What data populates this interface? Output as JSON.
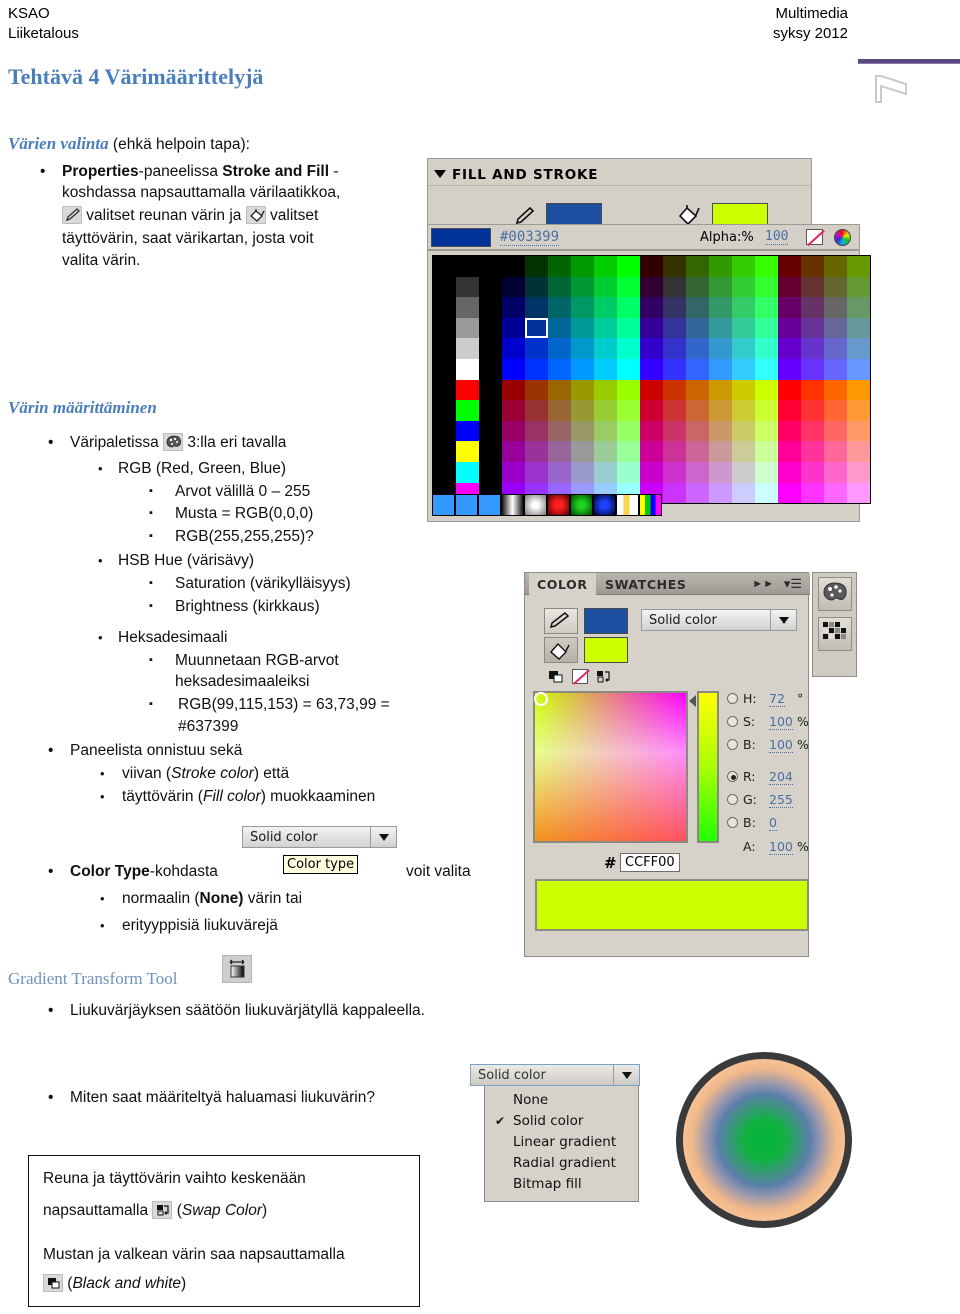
{
  "header": {
    "org": "KSAO",
    "dept": "Liiketalous",
    "course": "Multimedia",
    "term": "syksy 2012",
    "flag_icon": "flag-icon"
  },
  "page_title": "Tehtävä 4 Värimäärittelyjä",
  "sections": {
    "color_selection": {
      "heading": "Värien valinta",
      "heading_rest": " (ehkä helpoin tapa):",
      "bullet": {
        "line1_bold1": "Properties",
        "line1_mid": "-paneelissa ",
        "line1_bold2": "Stroke and Fill",
        "line1_end": " -",
        "line2": "koshdassa napsauttamalla värilaatikkoa,",
        "line3_a": " valitset reunan värin ja ",
        "line3_b": " valitset",
        "line4": "täyttövärin, saat värikartan, josta voit",
        "line5": "valita värin."
      }
    },
    "color_definition": {
      "heading": "Värin määrittäminen",
      "items": [
        {
          "level": 1,
          "text_before": "Väripaletissa ",
          "icon": "palette-icon",
          "text_after": " 3:lla eri tavalla"
        },
        {
          "level": 2,
          "text": "RGB (Red, Green, Blue)"
        },
        {
          "level": 3,
          "text": "Arvot välillä 0 – 255"
        },
        {
          "level": 3,
          "text": "Musta = RGB(0,0,0)"
        },
        {
          "level": 3,
          "text": "RGB(255,255,255)?"
        },
        {
          "level": 2,
          "text": "HSB Hue (värisävy)"
        },
        {
          "level": 3,
          "text": "Saturation (värikylläisyys)"
        },
        {
          "level": 3,
          "text": "Brightness (kirkkaus)"
        },
        {
          "level": 2,
          "text": "Heksadesimaali"
        },
        {
          "level": 3,
          "text": "Muunnetaan RGB-arvot"
        },
        {
          "level": 3,
          "continuation": true,
          "text": "heksadesimaaleiksi"
        },
        {
          "level": 3,
          "text": "RGB(99,115,153) = 63,73,99 ="
        },
        {
          "level": 3,
          "continuation": true,
          "text": "#637399"
        },
        {
          "level": 1,
          "text": "Paneelista onnistuu sekä"
        },
        {
          "level": 2,
          "text_plain": "viivan (",
          "text_italic": "Stroke color",
          "text_tail": ") että"
        },
        {
          "level": 2,
          "text_plain": "täyttövärin (",
          "text_italic": "Fill color",
          "text_tail": ") muokkaaminen"
        }
      ],
      "color_type": {
        "bold": "Color Type",
        "rest": "-kohdasta",
        "combo_value": "Solid color",
        "tooltip": "Color type",
        "tail": "voit valita",
        "sub1_a": "normaalin (",
        "sub1_b": "None)",
        "sub1_c": " värin tai",
        "sub2": "erityyppisiä liukuvärejä"
      }
    },
    "gradient_tool": {
      "heading": "Gradient Transform Tool",
      "icon": "gradient-transform-icon",
      "bullet": "Liukuvärjäyksen säätöön liukuvärjätyllä kappaleella."
    },
    "question": "Miten saat määriteltyä haluamasi liukuvärin?",
    "note_box": {
      "line1": "Reuna ja täyttövärin vaihto keskenään",
      "line2_a": "napsauttamalla ",
      "line2_icon": "swap-color-icon",
      "line2_b": " (",
      "line2_italic": "Swap Color",
      "line2_c": ")",
      "line3": "Mustan ja valkean värin saa napsauttamalla",
      "line4_icon": "black-and-white-icon",
      "line4_a": " (",
      "line4_italic": "Black and white",
      "line4_b": ")"
    }
  },
  "fill_and_stroke_panel": {
    "title": "FILL AND STROKE",
    "stroke_icon": "pencil-icon",
    "fill_icon": "paint-bucket-icon",
    "stroke_color": "#1d4fa0",
    "fill_color": "#ccff00",
    "current_swatch": "#003399",
    "hex_value": "#003399",
    "alpha_label": "Alpha:%",
    "alpha_value": "100",
    "no_color_icon": "no-color-icon",
    "color_wheel_icon": "color-wheel-icon",
    "selected_swatch": "#0033aa"
  },
  "color_panel": {
    "tabs": [
      {
        "label": "COLOR",
        "active": true
      },
      {
        "label": "SWATCHES",
        "active": false
      }
    ],
    "expand_icon": "double-chevron-icon",
    "menu_icon": "panel-menu-icon",
    "side_buttons": [
      {
        "icon": "palette-icon"
      },
      {
        "icon": "swatches-grid-icon"
      }
    ],
    "stroke_icon": "pencil-icon",
    "fill_icon": "paint-bucket-icon",
    "stroke_color": "#1d4fa0",
    "fill_color": "#ccff00",
    "black_white_icon": "black-and-white-icon",
    "no_color_icon": "no-color-icon",
    "swap_color_icon": "swap-color-icon",
    "color_type_value": "Solid color",
    "fields": [
      {
        "name": "H",
        "value": "72",
        "unit": "°",
        "selected": false
      },
      {
        "name": "S",
        "value": "100",
        "unit": "%",
        "selected": false
      },
      {
        "name": "B",
        "value": "100",
        "unit": "%",
        "selected": false
      },
      {
        "name": "R",
        "value": "204",
        "unit": "",
        "selected": true
      },
      {
        "name": "G",
        "value": "255",
        "unit": "",
        "selected": false
      },
      {
        "name": "B",
        "value": "0",
        "unit": "",
        "selected": false
      },
      {
        "name": "A",
        "value": "100",
        "unit": "%",
        "selected": null
      }
    ],
    "hex_symbol": "#",
    "hex_value": "CCFF00",
    "preview_color": "#ccff00"
  },
  "color_type_dropdown": {
    "selected": "Solid color",
    "options": [
      {
        "label": "None",
        "checked": false
      },
      {
        "label": "Solid color",
        "checked": true
      },
      {
        "label": "Linear gradient",
        "checked": false
      },
      {
        "label": "Radial gradient",
        "checked": false
      },
      {
        "label": "Bitmap fill",
        "checked": false
      }
    ]
  },
  "gradient_circle": {
    "name": "radial-gradient-circle",
    "center_color": "#00b33c",
    "mid_color": "#5b7fa8",
    "outer_color": "#f8c79c",
    "stroke_color": "#3a3a3c"
  },
  "palette_grid": {
    "rows": [
      [
        "#000000",
        "#000000",
        "#000000",
        "#000000",
        "#003300",
        "#006600",
        "#009900",
        "#00cc00",
        "#00ff00",
        "#330000",
        "#333300",
        "#336600",
        "#339900",
        "#33cc00",
        "#33ff00",
        "#660000",
        "#663300",
        "#666600",
        "#669900"
      ],
      [
        "#000000",
        "#333333",
        "#000000",
        "#000033",
        "#003333",
        "#006633",
        "#009933",
        "#00cc33",
        "#00ff33",
        "#330033",
        "#333333",
        "#336633",
        "#339933",
        "#33cc33",
        "#33ff33",
        "#660033",
        "#663333",
        "#666633",
        "#669933"
      ],
      [
        "#000000",
        "#666666",
        "#000000",
        "#000066",
        "#003366",
        "#006666",
        "#009966",
        "#00cc66",
        "#00ff66",
        "#330066",
        "#333366",
        "#336666",
        "#339966",
        "#33cc66",
        "#33ff66",
        "#660066",
        "#663366",
        "#666666",
        "#669966"
      ],
      [
        "#000000",
        "#999999",
        "#000000",
        "#000099",
        "#003399",
        "#006699",
        "#009999",
        "#00cc99",
        "#00ff99",
        "#330099",
        "#333399",
        "#336699",
        "#339999",
        "#33cc99",
        "#33ff99",
        "#660099",
        "#663399",
        "#666699",
        "#669999"
      ],
      [
        "#000000",
        "#cccccc",
        "#000000",
        "#0000cc",
        "#0033cc",
        "#0066cc",
        "#0099cc",
        "#00cccc",
        "#00ffcc",
        "#3300cc",
        "#3333cc",
        "#3366cc",
        "#3399cc",
        "#33cccc",
        "#33ffcc",
        "#6600cc",
        "#6633cc",
        "#6666cc",
        "#6699cc"
      ],
      [
        "#000000",
        "#ffffff",
        "#000000",
        "#0000ff",
        "#0033ff",
        "#0066ff",
        "#0099ff",
        "#00ccff",
        "#00ffff",
        "#3300ff",
        "#3333ff",
        "#3366ff",
        "#3399ff",
        "#33ccff",
        "#33ffff",
        "#6600ff",
        "#6633ff",
        "#6666ff",
        "#6699ff"
      ],
      [
        "#000000",
        "#ff0000",
        "#000000",
        "#990000",
        "#993300",
        "#996600",
        "#999900",
        "#99cc00",
        "#99ff00",
        "#cc0000",
        "#cc3300",
        "#cc6600",
        "#cc9900",
        "#cccc00",
        "#ccff00",
        "#ff0000",
        "#ff3300",
        "#ff6600",
        "#ff9900"
      ],
      [
        "#000000",
        "#00ff00",
        "#000000",
        "#990033",
        "#993333",
        "#996633",
        "#999933",
        "#99cc33",
        "#99ff33",
        "#cc0033",
        "#cc3333",
        "#cc6633",
        "#cc9933",
        "#cccc33",
        "#ccff33",
        "#ff0033",
        "#ff3333",
        "#ff6633",
        "#ff9933"
      ],
      [
        "#000000",
        "#0000ff",
        "#000000",
        "#990066",
        "#993366",
        "#996666",
        "#999966",
        "#99cc66",
        "#99ff66",
        "#cc0066",
        "#cc3366",
        "#cc6666",
        "#cc9966",
        "#cccc66",
        "#ccff66",
        "#ff0066",
        "#ff3366",
        "#ff6666",
        "#ff9966"
      ],
      [
        "#000000",
        "#ffff00",
        "#000000",
        "#990099",
        "#993399",
        "#996699",
        "#999999",
        "#99cc99",
        "#99ff99",
        "#cc0099",
        "#cc3399",
        "#cc6699",
        "#cc9999",
        "#cccc99",
        "#ccff99",
        "#ff0099",
        "#ff3399",
        "#ff6699",
        "#ff9999"
      ],
      [
        "#000000",
        "#00ffff",
        "#000000",
        "#9900cc",
        "#9933cc",
        "#9966cc",
        "#9999cc",
        "#99cccc",
        "#99ffcc",
        "#cc00cc",
        "#cc33cc",
        "#cc66cc",
        "#cc99cc",
        "#cccccc",
        "#ccffcc",
        "#ff00cc",
        "#ff33cc",
        "#ff66cc",
        "#ff99cc"
      ],
      [
        "#000000",
        "#ff00ff",
        "#000000",
        "#9900ff",
        "#9933ff",
        "#9966ff",
        "#9999ff",
        "#99ccff",
        "#99ffff",
        "#cc00ff",
        "#cc33ff",
        "#cc66ff",
        "#cc99ff",
        "#ccccff",
        "#ccffff",
        "#ff00ff",
        "#ff33ff",
        "#ff66ff",
        "#ff99ff"
      ]
    ],
    "bottom_row": [
      "#3399ff",
      "#3399ff",
      "#3399ff",
      "gradient-gray",
      "gradient-white",
      "gradient-red",
      "gradient-green",
      "gradient-blue",
      "gradient-stripes",
      "gradient-rainbow"
    ]
  }
}
